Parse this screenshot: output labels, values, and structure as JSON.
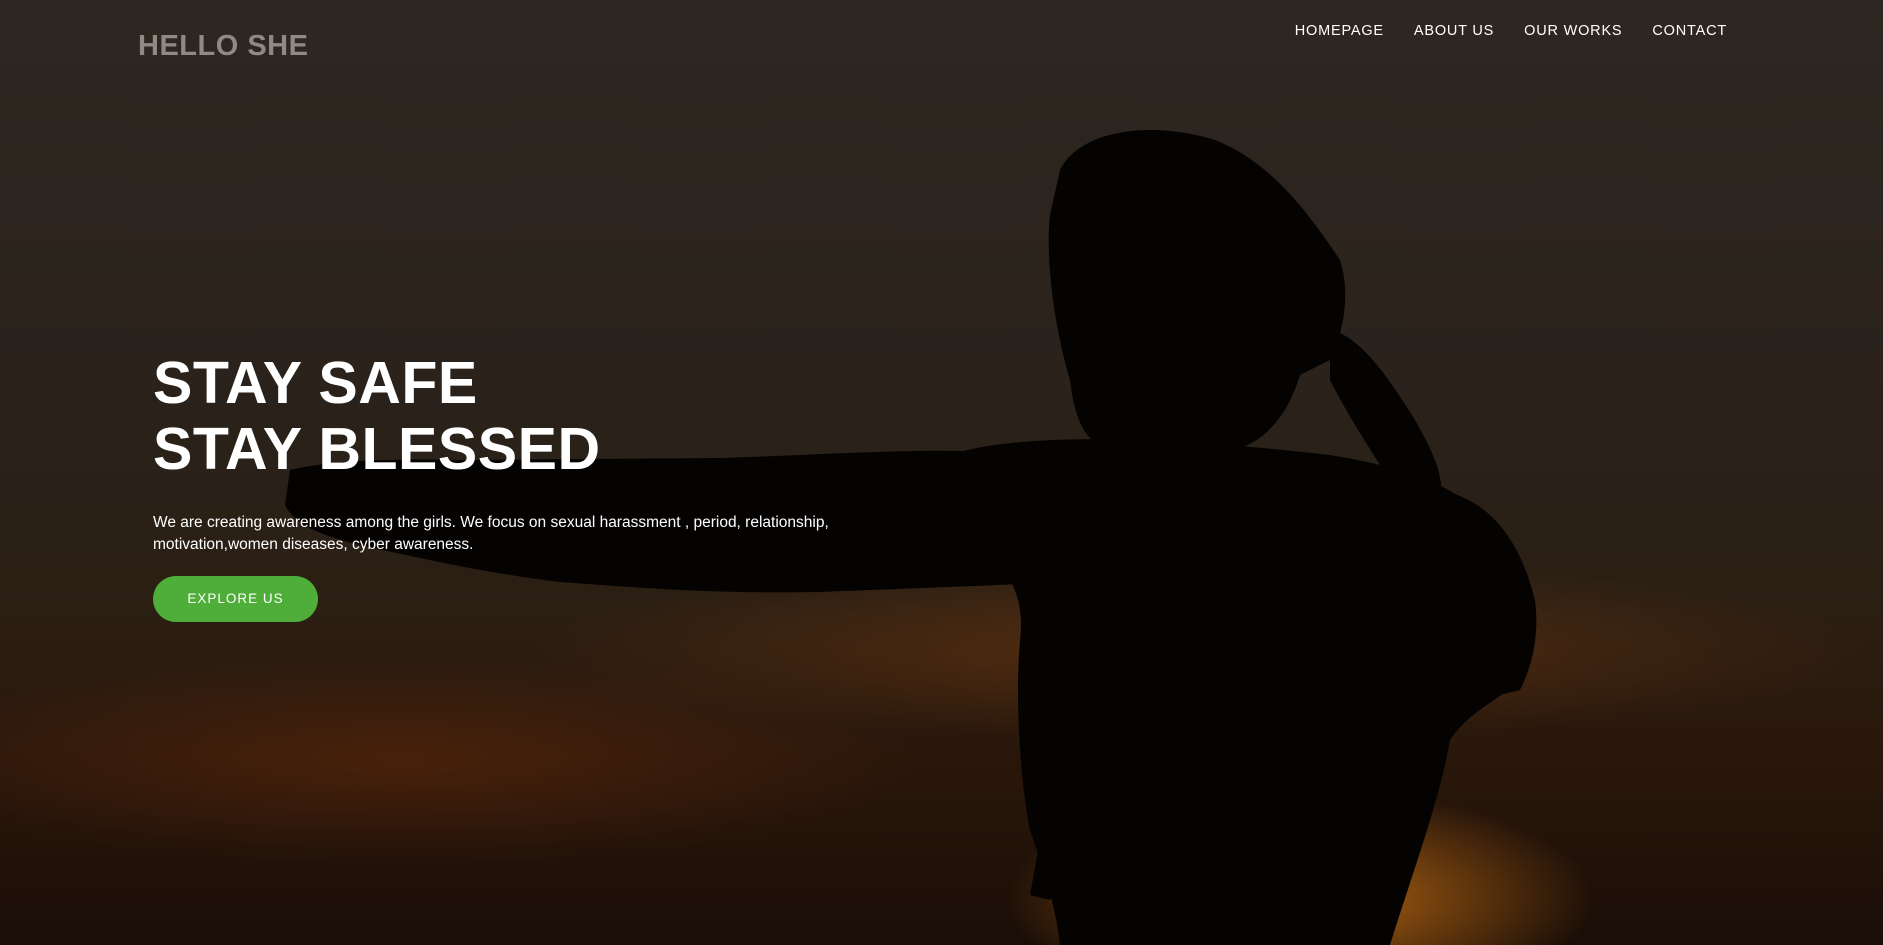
{
  "header": {
    "logo": "HELLO SHE",
    "nav": [
      "HOMEPAGE",
      "ABOUT US",
      "OUR WORKS",
      "CONTACT"
    ]
  },
  "hero": {
    "headline_line1": "STAY SAFE",
    "headline_line2": "STAY BLESSED",
    "description": "We are creating awareness among the girls. We focus on sexual harassment , period, relationship, motivation,women diseases, cyber awareness.",
    "cta_label": "EXPLORE US",
    "background_image": "silhouette of a girl at sunset",
    "colors": {
      "accent": "#4fae3a",
      "logo": "#8f8a83",
      "text": "#ffffff"
    }
  }
}
